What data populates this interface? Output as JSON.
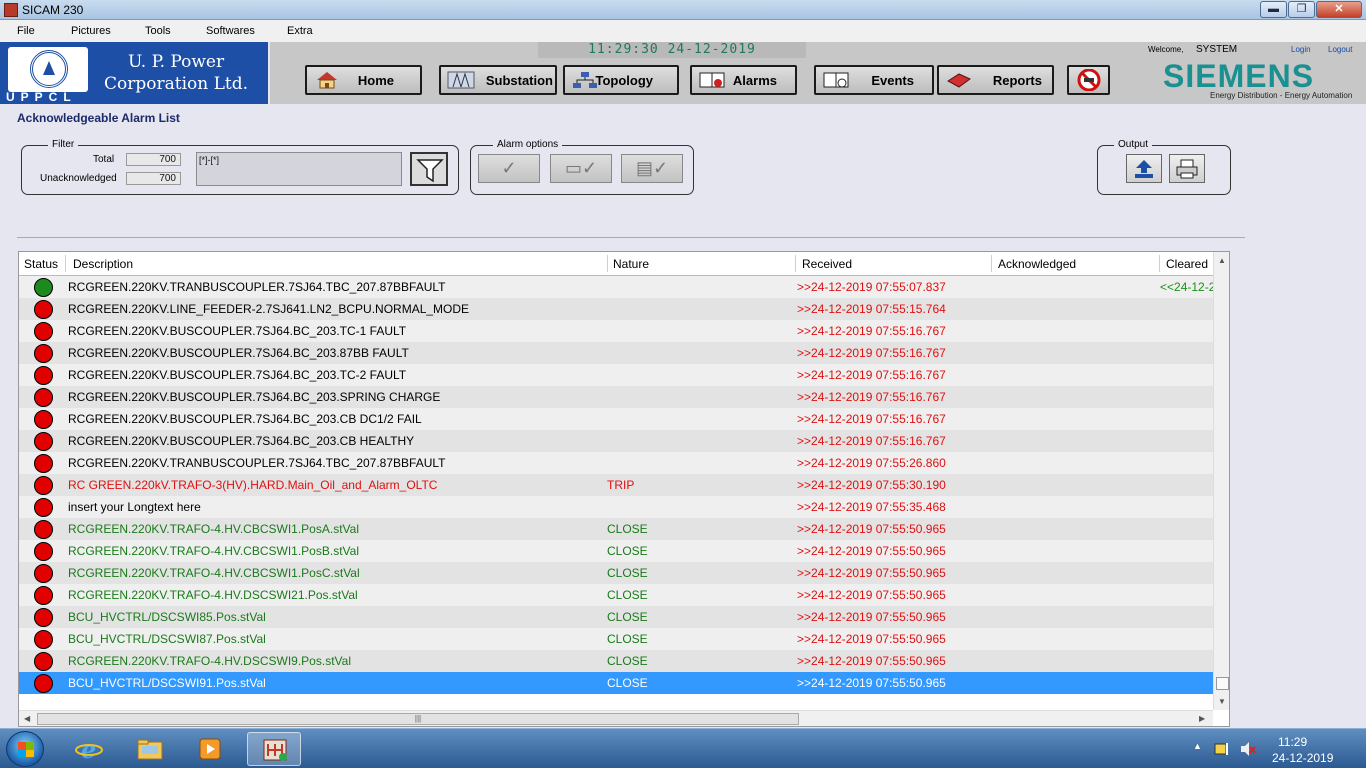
{
  "window": {
    "title": "SICAM 230",
    "minimize": "▬",
    "maximize": "❐",
    "close": "✕"
  },
  "menu": [
    "File",
    "Pictures",
    "Tools",
    "Softwares",
    "Extra"
  ],
  "logo": {
    "line1": "U. P. Power",
    "line2": "Corporation Ltd.",
    "line3": "UPPCL"
  },
  "header": {
    "clock": "11:29:30  24-12-2019",
    "welcome": "Welcome,",
    "user": "SYSTEM",
    "login": "Login",
    "logout": "Logout",
    "brand": "SIEMENS",
    "tagline": "Energy Distribution - Energy Automation"
  },
  "nav": {
    "home": "Home",
    "substation": "Substation",
    "topology": "Topology",
    "alarms": "Alarms",
    "events": "Events",
    "reports": "Reports"
  },
  "page_title": "Acknowledgeable Alarm List",
  "filter": {
    "legend": "Filter",
    "total_label": "Total",
    "total_value": "700",
    "unack_label": "Unacknowledged",
    "unack_value": "700",
    "filter_string": "[*]-[*]"
  },
  "alarm_options": {
    "legend": "Alarm options"
  },
  "output": {
    "legend": "Output"
  },
  "table": {
    "columns": [
      "Status",
      "Description",
      "Nature",
      "Received",
      "Acknowledged",
      "Cleared"
    ],
    "rows": [
      {
        "status": "green",
        "description": "RCGREEN.220KV.TRANBUSCOUPLER.7SJ64.TBC_207.87BBFAULT",
        "nature": "",
        "received": ">>24-12-2019 07:55:07.837",
        "acknowledged": "",
        "cleared": "<<24-12-2",
        "color": "#000000"
      },
      {
        "status": "red",
        "description": "RCGREEN.220KV.LINE_FEEDER-2.7SJ641.LN2_BCPU.NORMAL_MODE",
        "nature": "",
        "received": ">>24-12-2019 07:55:15.764",
        "acknowledged": "",
        "cleared": "",
        "color": "#000000"
      },
      {
        "status": "red",
        "description": "RCGREEN.220KV.BUSCOUPLER.7SJ64.BC_203.TC-1 FAULT",
        "nature": "",
        "received": ">>24-12-2019 07:55:16.767",
        "acknowledged": "",
        "cleared": "",
        "color": "#000000"
      },
      {
        "status": "red",
        "description": "RCGREEN.220KV.BUSCOUPLER.7SJ64.BC_203.87BB FAULT",
        "nature": "",
        "received": ">>24-12-2019 07:55:16.767",
        "acknowledged": "",
        "cleared": "",
        "color": "#000000"
      },
      {
        "status": "red",
        "description": "RCGREEN.220KV.BUSCOUPLER.7SJ64.BC_203.TC-2 FAULT",
        "nature": "",
        "received": ">>24-12-2019 07:55:16.767",
        "acknowledged": "",
        "cleared": "",
        "color": "#000000"
      },
      {
        "status": "red",
        "description": "RCGREEN.220KV.BUSCOUPLER.7SJ64.BC_203.SPRING CHARGE",
        "nature": "",
        "received": ">>24-12-2019 07:55:16.767",
        "acknowledged": "",
        "cleared": "",
        "color": "#000000"
      },
      {
        "status": "red",
        "description": "RCGREEN.220KV.BUSCOUPLER.7SJ64.BC_203.CB DC1/2 FAIL",
        "nature": "",
        "received": ">>24-12-2019 07:55:16.767",
        "acknowledged": "",
        "cleared": "",
        "color": "#000000"
      },
      {
        "status": "red",
        "description": "RCGREEN.220KV.BUSCOUPLER.7SJ64.BC_203.CB HEALTHY",
        "nature": "",
        "received": ">>24-12-2019 07:55:16.767",
        "acknowledged": "",
        "cleared": "",
        "color": "#000000"
      },
      {
        "status": "red",
        "description": "RCGREEN.220KV.TRANBUSCOUPLER.7SJ64.TBC_207.87BBFAULT",
        "nature": "",
        "received": ">>24-12-2019 07:55:26.860",
        "acknowledged": "",
        "cleared": "",
        "color": "#000000"
      },
      {
        "status": "red",
        "description": "RC GREEN.220kV.TRAFO-3(HV).HARD.Main_Oil_and_Alarm_OLTC",
        "nature": "TRIP",
        "received": ">>24-12-2019 07:55:30.190",
        "acknowledged": "",
        "cleared": "",
        "color": "#e01010"
      },
      {
        "status": "red",
        "description": "insert your Longtext here",
        "nature": "",
        "received": ">>24-12-2019 07:55:35.468",
        "acknowledged": "",
        "cleared": "",
        "color": "#000000"
      },
      {
        "status": "red",
        "description": "RCGREEN.220KV.TRAFO-4.HV.CBCSWI1.PosA.stVal",
        "nature": "CLOSE",
        "received": ">>24-12-2019 07:55:50.965",
        "acknowledged": "",
        "cleared": "",
        "color": "#1a7a1a"
      },
      {
        "status": "red",
        "description": "RCGREEN.220KV.TRAFO-4.HV.CBCSWI1.PosB.stVal",
        "nature": "CLOSE",
        "received": ">>24-12-2019 07:55:50.965",
        "acknowledged": "",
        "cleared": "",
        "color": "#1a7a1a"
      },
      {
        "status": "red",
        "description": "RCGREEN.220KV.TRAFO-4.HV.CBCSWI1.PosC.stVal",
        "nature": "CLOSE",
        "received": ">>24-12-2019 07:55:50.965",
        "acknowledged": "",
        "cleared": "",
        "color": "#1a7a1a"
      },
      {
        "status": "red",
        "description": "RCGREEN.220KV.TRAFO-4.HV.DSCSWI21.Pos.stVal",
        "nature": "CLOSE",
        "received": ">>24-12-2019 07:55:50.965",
        "acknowledged": "",
        "cleared": "",
        "color": "#1a7a1a"
      },
      {
        "status": "red",
        "description": "BCU_HVCTRL/DSCSWI85.Pos.stVal",
        "nature": "CLOSE",
        "received": ">>24-12-2019 07:55:50.965",
        "acknowledged": "",
        "cleared": "",
        "color": "#1a7a1a"
      },
      {
        "status": "red",
        "description": "BCU_HVCTRL/DSCSWI87.Pos.stVal",
        "nature": "CLOSE",
        "received": ">>24-12-2019 07:55:50.965",
        "acknowledged": "",
        "cleared": "",
        "color": "#1a7a1a"
      },
      {
        "status": "red",
        "description": "RCGREEN.220KV.TRAFO-4.HV.DSCSWI9.Pos.stVal",
        "nature": "CLOSE",
        "received": ">>24-12-2019 07:55:50.965",
        "acknowledged": "",
        "cleared": "",
        "color": "#1a7a1a"
      },
      {
        "status": "red",
        "description": "BCU_HVCTRL/DSCSWI91.Pos.stVal",
        "nature": "CLOSE",
        "received": ">>24-12-2019 07:55:50.965",
        "acknowledged": "",
        "cleared": "",
        "color": "#ffffff",
        "selected": true
      }
    ]
  },
  "colors": {
    "selected_row": "#3399ff",
    "stripe": "#e3e3e3",
    "status_red": "#e00000",
    "status_green": "#1c8a1c"
  },
  "taskbar": {
    "time": "11:29",
    "date": "24-12-2019",
    "apps": [
      "internet-explorer",
      "file-explorer",
      "media-player",
      "sicam-230"
    ]
  }
}
